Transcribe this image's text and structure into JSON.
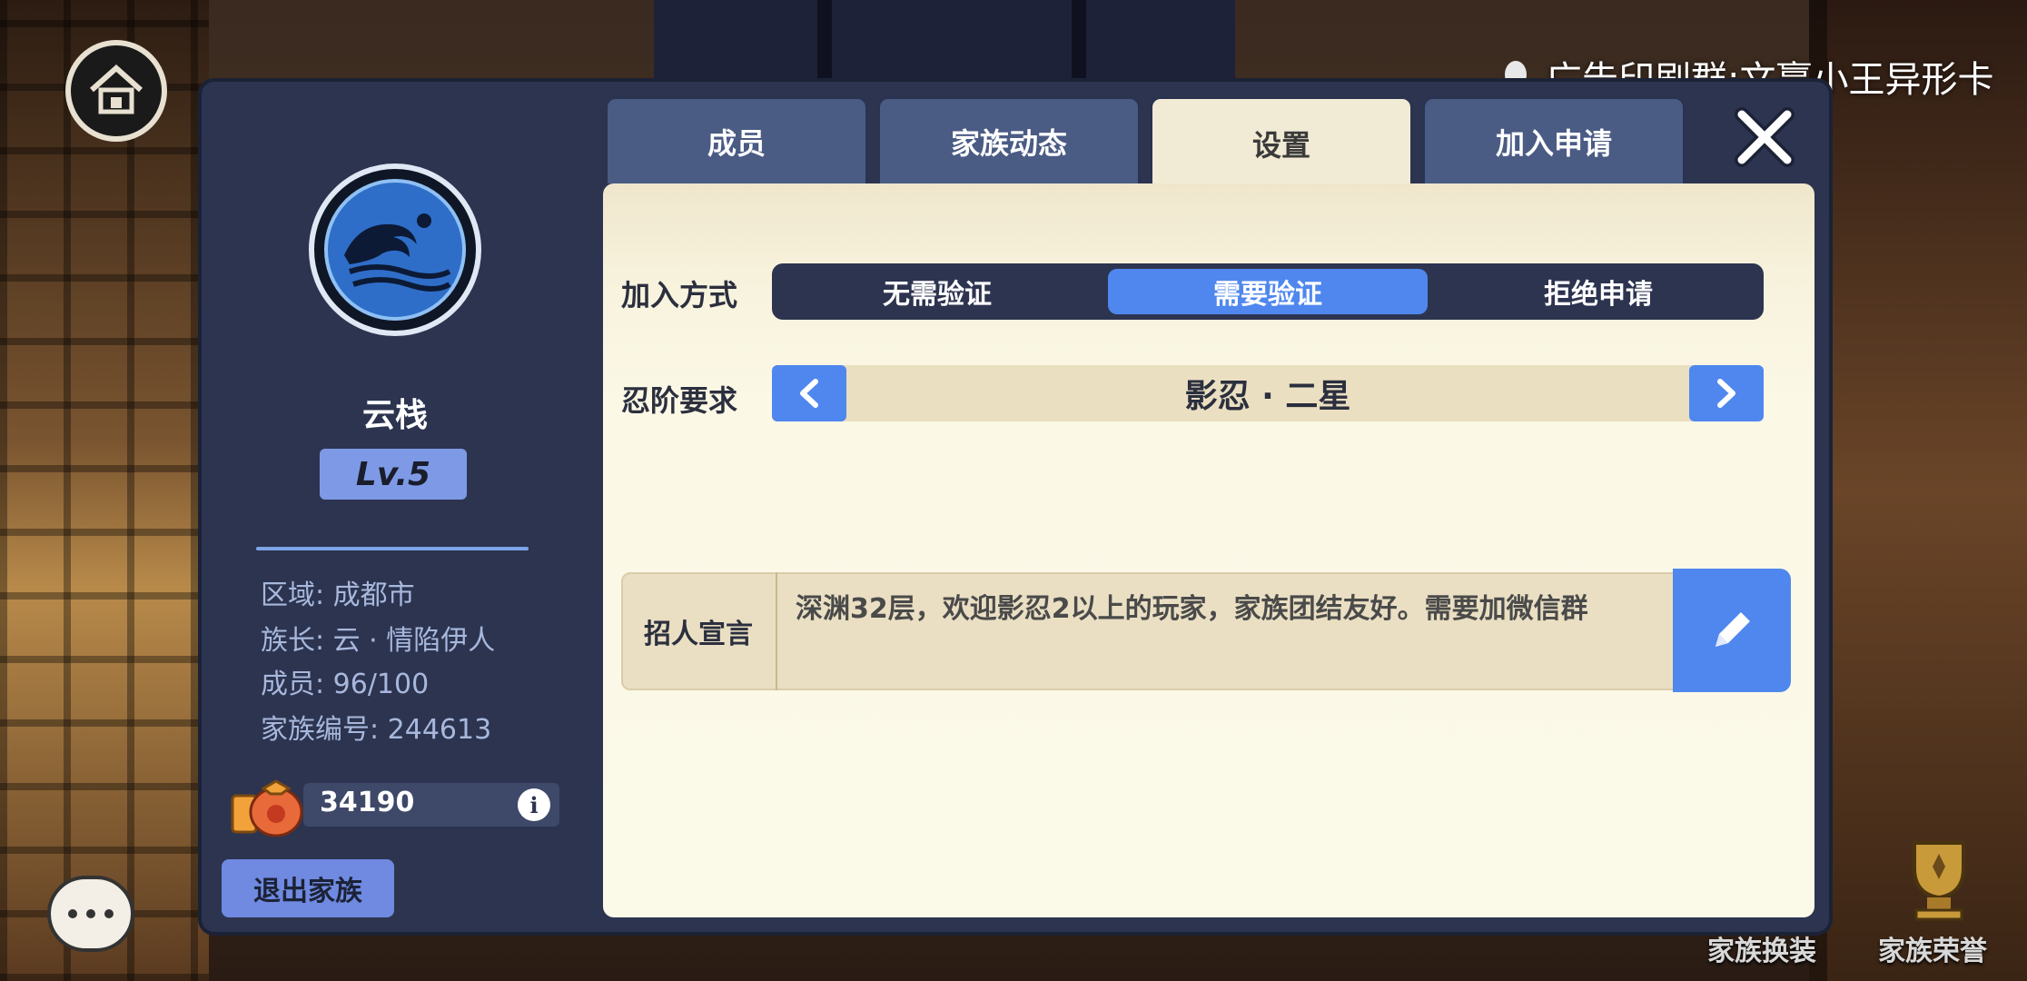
{
  "ad": {
    "text": "广告印刷群:文赢小王异形卡"
  },
  "background_top": {
    "title": "云栈"
  },
  "tabs": [
    {
      "label": "成员"
    },
    {
      "label": "家族动态"
    },
    {
      "label": "设置"
    },
    {
      "label": "加入申请"
    }
  ],
  "active_tab": "设置",
  "clan": {
    "name": "云栈",
    "level": "Lv.5",
    "region": "区域: 成都市",
    "leader": "族长: 云 · 情陷伊人",
    "members": "成员: 96/100",
    "clan_id": "家族编号: 244613",
    "funds": "34190"
  },
  "buttons": {
    "quit": "退出家族"
  },
  "settings": {
    "join_label": "加入方式",
    "join_options": [
      "无需验证",
      "需要验证",
      "拒绝申请"
    ],
    "join_selected": "需要验证",
    "rank_label": "忍阶要求",
    "rank_value": "影忍 · 二星",
    "declaration_label": "招人宣言",
    "declaration_text": "深渊32层，欢迎影忍2以上的玩家，家族团结友好。需要加微信群"
  },
  "bottom_right": {
    "outfit": "家族换装",
    "honor": "家族荣誉"
  },
  "colors": {
    "panel": "#2c3450",
    "accent": "#4f87ee",
    "content_bg": "#fbf9e8"
  }
}
